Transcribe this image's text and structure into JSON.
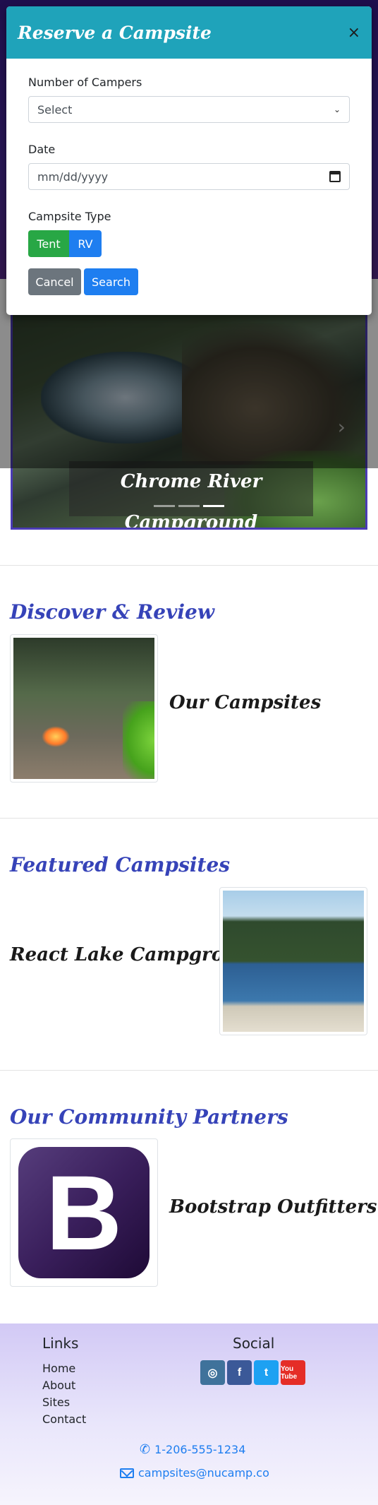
{
  "modal": {
    "title": "Reserve a Campsite",
    "close_icon": "×",
    "campers_label": "Number of Campers",
    "campers_value": "Select",
    "date_label": "Date",
    "date_value": "mm/dd/yyyy",
    "type_label": "Campsite Type",
    "type_tent": "Tent",
    "type_rv": "RV",
    "cancel_label": "Cancel",
    "search_label": "Search"
  },
  "carousel": {
    "caption": "Chrome River Campground",
    "next_icon": "›",
    "indicator_count": 3,
    "active_index": 2
  },
  "sections": {
    "discover": {
      "title": "Discover & Review",
      "item": "Our Campsites"
    },
    "featured": {
      "title": "Featured Campsites",
      "item": "React Lake Campground"
    },
    "partners": {
      "title": "Our Community Partners",
      "item": "Bootstrap Outfitters",
      "logo_letter": "B"
    }
  },
  "footer": {
    "links_heading": "Links",
    "links": [
      "Home",
      "About",
      "Sites",
      "Contact"
    ],
    "social_heading": "Social",
    "social_icons": [
      "instagram-icon",
      "facebook-icon",
      "twitter-icon",
      "youtube-icon"
    ],
    "social_glyphs": [
      "◎",
      "f",
      "t",
      "You Tube"
    ],
    "phone": "1-206-555-1234",
    "email": "campsites@nucamp.co"
  },
  "colors": {
    "modal_header": "#1fa3ba",
    "section_title": "#3643b8",
    "primary": "#1e7ef0",
    "success": "#28a745"
  }
}
